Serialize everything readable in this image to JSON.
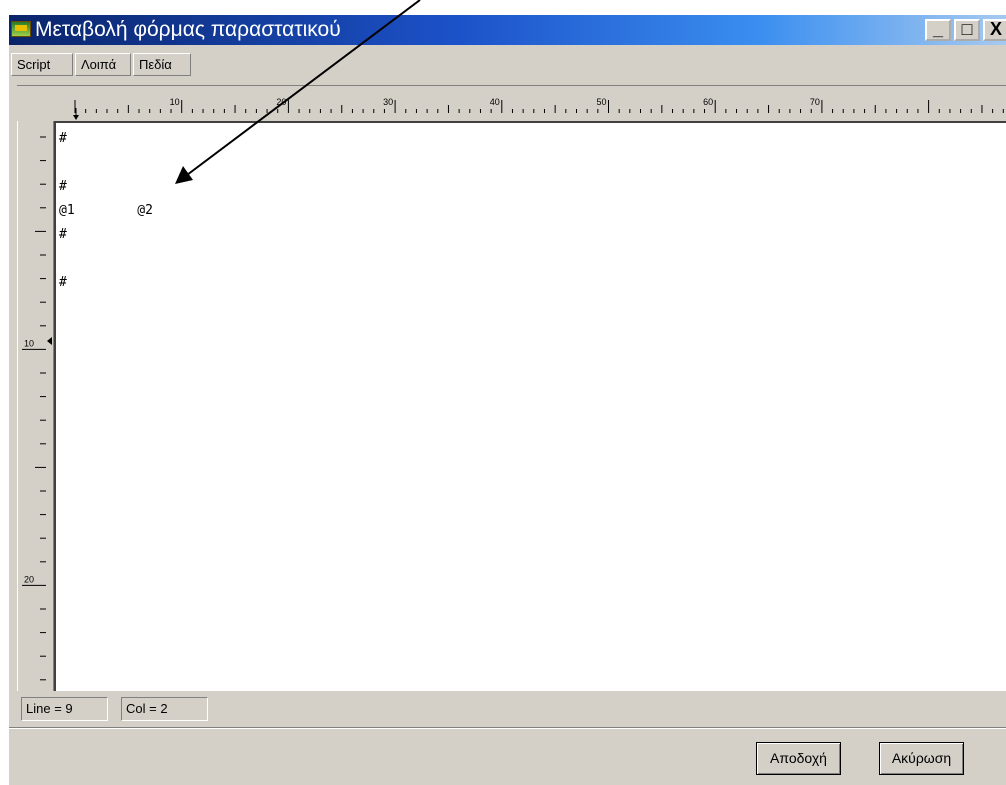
{
  "window": {
    "title": "Μεταβολή φόρμας παραστατικού",
    "controls": [
      "_",
      "□",
      "X"
    ]
  },
  "tabs": [
    {
      "label": "Script"
    },
    {
      "label": "Λοιπά"
    },
    {
      "label": "Πεδία"
    }
  ],
  "ruler": {
    "horizontal_labels": [
      "10",
      "20",
      "30",
      "40",
      "50",
      "60",
      "70"
    ],
    "vertical_labels": [
      "10",
      "20"
    ]
  },
  "editor": {
    "lines": [
      "#",
      "",
      "#",
      "@1        @2",
      "#",
      "",
      "#"
    ]
  },
  "status": {
    "line": "Line = 9",
    "col": "Col = 2"
  },
  "buttons": {
    "accept": "Αποδοχή",
    "cancel": "Ακύρωση"
  },
  "icons": {
    "app": "app-icon",
    "annotation": "arrow-pointer-icon"
  }
}
